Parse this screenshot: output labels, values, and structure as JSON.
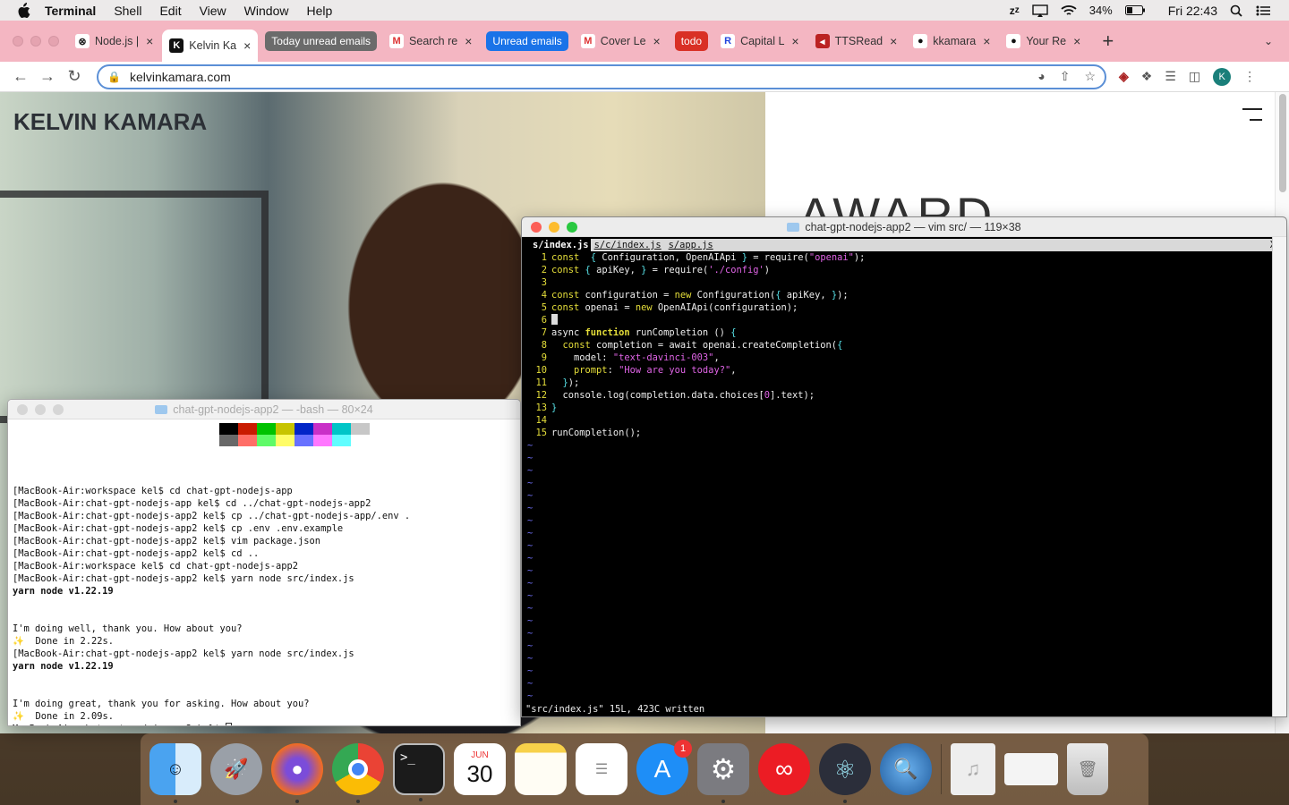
{
  "menubar": {
    "app": "Terminal",
    "items": [
      "Shell",
      "Edit",
      "View",
      "Window",
      "Help"
    ],
    "battery": "34%",
    "clock": "Fri 22:43"
  },
  "tabs": [
    {
      "label": "Node.js |",
      "fav": "⊗",
      "favbg": "#fff",
      "favcolor": "#222"
    },
    {
      "label": "Kelvin Ka",
      "fav": "K",
      "favbg": "#111",
      "favcolor": "#fff",
      "active": true
    },
    {
      "group": "Today unread emails",
      "color": "#6b6b6b"
    },
    {
      "label": "Search re",
      "fav": "M",
      "favbg": "#fff",
      "favcolor": "#d33"
    },
    {
      "group": "Unread emails",
      "color": "#1a73e8"
    },
    {
      "label": "Cover Le",
      "fav": "M",
      "favbg": "#fff",
      "favcolor": "#d33"
    },
    {
      "group": "todo",
      "color": "#d93025"
    },
    {
      "label": "Capital L",
      "fav": "R",
      "favbg": "#fff",
      "favcolor": "#2244dd"
    },
    {
      "label": "TTSRead",
      "fav": "◂",
      "favbg": "#b22",
      "favcolor": "#fff"
    },
    {
      "label": "kkamara",
      "fav": "●",
      "favbg": "#fff",
      "favcolor": "#111"
    },
    {
      "label": "Your Re",
      "fav": "●",
      "favbg": "#fff",
      "favcolor": "#111"
    }
  ],
  "omnibox": {
    "url": "kelvinkamara.com"
  },
  "site": {
    "title": "KELVIN KAMARA",
    "award": "AWARD"
  },
  "term1": {
    "title": "chat-gpt-nodejs-app2 — -bash — 80×24",
    "palette": [
      "#000000",
      "#c91b00",
      "#00c200",
      "#c7c400",
      "#0225c7",
      "#c930c7",
      "#00c5c7",
      "#c7c7c7",
      "#686868",
      "#ff6e67",
      "#5ffa68",
      "#fffc67",
      "#6871ff",
      "#ff77ff",
      "#60fdff",
      "#ffffff"
    ],
    "lines": [
      {
        "t": "",
        "b": false
      },
      {
        "t": "[MacBook-Air:workspace kel$ cd chat-gpt-nodejs-app",
        "b": false
      },
      {
        "t": "[MacBook-Air:chat-gpt-nodejs-app kel$ cd ../chat-gpt-nodejs-app2",
        "b": false
      },
      {
        "t": "[MacBook-Air:chat-gpt-nodejs-app2 kel$ cp ../chat-gpt-nodejs-app/.env .",
        "b": false
      },
      {
        "t": "[MacBook-Air:chat-gpt-nodejs-app2 kel$ cp .env .env.example",
        "b": false
      },
      {
        "t": "[MacBook-Air:chat-gpt-nodejs-app2 kel$ vim package.json",
        "b": false
      },
      {
        "t": "[MacBook-Air:chat-gpt-nodejs-app2 kel$ cd ..",
        "b": false
      },
      {
        "t": "[MacBook-Air:workspace kel$ cd chat-gpt-nodejs-app2",
        "b": false
      },
      {
        "t": "[MacBook-Air:chat-gpt-nodejs-app2 kel$ yarn node src/index.js",
        "b": false
      },
      {
        "t": "yarn node v1.22.19",
        "b": true
      },
      {
        "t": "",
        "b": false
      },
      {
        "t": "",
        "b": false
      },
      {
        "t": "I'm doing well, thank you. How about you?",
        "b": false
      },
      {
        "t": "✨  Done in 2.22s.",
        "b": false
      },
      {
        "t": "[MacBook-Air:chat-gpt-nodejs-app2 kel$ yarn node src/index.js",
        "b": false
      },
      {
        "t": "yarn node v1.22.19",
        "b": true
      },
      {
        "t": "",
        "b": false
      },
      {
        "t": "",
        "b": false
      },
      {
        "t": "I'm doing great, thank you for asking. How about you?",
        "b": false
      },
      {
        "t": "✨  Done in 2.09s.",
        "b": false
      }
    ],
    "prompt": "MacBook-Air:chat-gpt-nodejs-app2 kel$ "
  },
  "term2": {
    "title": "chat-gpt-nodejs-app2 — vim src/ — 119×38",
    "tabs": [
      "s/index.js",
      "s/c/index.js",
      "s/app.js"
    ],
    "close": "X",
    "code": [
      [
        [
          "kw",
          "const"
        ],
        [
          "",
          "  "
        ],
        [
          "br",
          "{"
        ],
        [
          "",
          " Configuration, OpenAIApi "
        ],
        [
          "br",
          "}"
        ],
        [
          "",
          " = require("
        ],
        [
          "st",
          "\"openai\""
        ],
        [
          "",
          ");"
        ]
      ],
      [
        [
          "kw",
          "const"
        ],
        [
          "",
          " "
        ],
        [
          "br",
          "{"
        ],
        [
          "",
          " apiKey, "
        ],
        [
          "br",
          "}"
        ],
        [
          "",
          " = require("
        ],
        [
          "st",
          "'./config'"
        ],
        [
          "",
          ")"
        ]
      ],
      [],
      [
        [
          "kw",
          "const"
        ],
        [
          "",
          " configuration = "
        ],
        [
          "kw",
          "new"
        ],
        [
          "",
          " Configuration("
        ],
        [
          "br",
          "{"
        ],
        [
          "",
          " apiKey, "
        ],
        [
          "br",
          "}"
        ],
        [
          "",
          ");"
        ]
      ],
      [
        [
          "kw",
          "const"
        ],
        [
          "",
          " openai = "
        ],
        [
          "kw",
          "new"
        ],
        [
          "",
          " OpenAIApi(configuration);"
        ]
      ],
      [
        [
          "cur",
          ""
        ]
      ],
      [
        [
          "",
          "async "
        ],
        [
          "fn",
          "function"
        ],
        [
          "",
          " runCompletion () "
        ],
        [
          "br",
          "{"
        ]
      ],
      [
        [
          "",
          "  "
        ],
        [
          "kw",
          "const"
        ],
        [
          "",
          " completion = await openai.createCompletion("
        ],
        [
          "br",
          "{"
        ]
      ],
      [
        [
          "",
          "    model: "
        ],
        [
          "st",
          "\"text-davinci-003\""
        ],
        [
          "",
          ","
        ]
      ],
      [
        [
          "",
          "    "
        ],
        [
          "kw",
          "prompt"
        ],
        [
          "",
          ": "
        ],
        [
          "st",
          "\"How are you today?\""
        ],
        [
          "",
          ","
        ]
      ],
      [
        [
          "",
          "  "
        ],
        [
          "br",
          "}"
        ],
        [
          "",
          ");"
        ]
      ],
      [
        [
          "",
          "  console.log(completion.data.choices["
        ],
        [
          "nm",
          "0"
        ],
        [
          "",
          "].text);"
        ]
      ],
      [
        [
          "br",
          "}"
        ]
      ],
      [],
      [
        [
          "",
          "runCompletion();"
        ]
      ]
    ],
    "tilde_count": 21,
    "status": "\"src/index.js\" 15L, 423C written"
  },
  "dock": {
    "calendar_month": "JUN",
    "calendar_day": "30",
    "appstore_badge": "1"
  }
}
